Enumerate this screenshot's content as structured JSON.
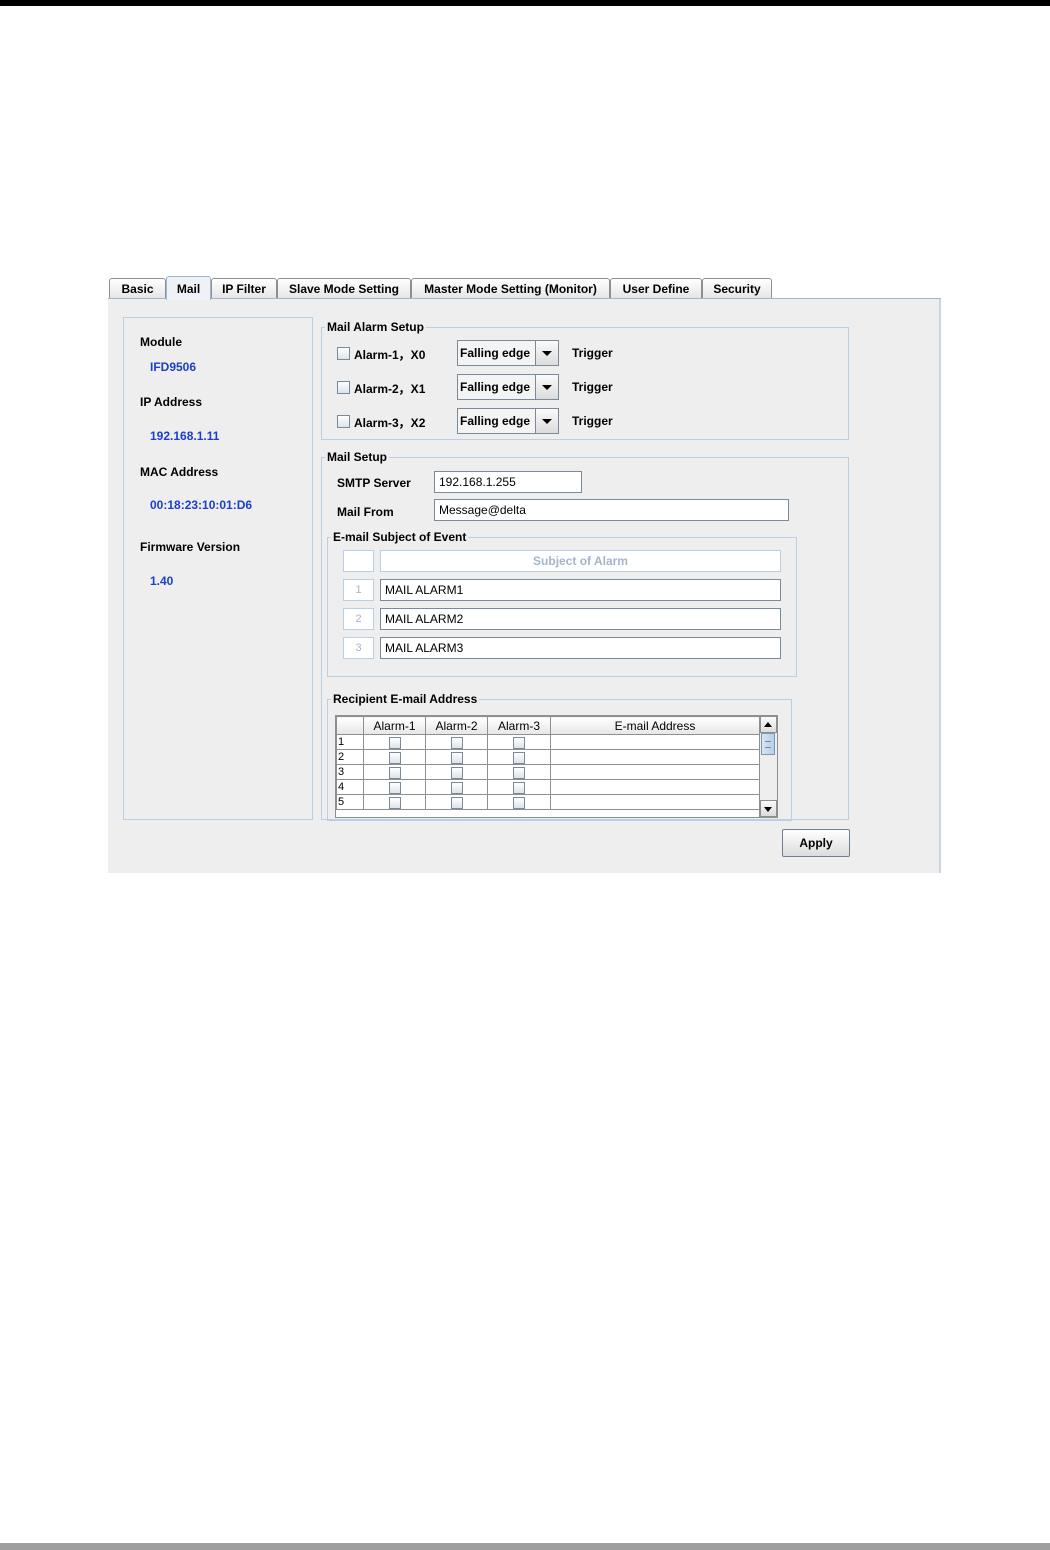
{
  "tabs": [
    {
      "label": "Basic",
      "active": false
    },
    {
      "label": "Mail",
      "active": true
    },
    {
      "label": "IP Filter",
      "active": false
    },
    {
      "label": "Slave Mode Setting",
      "active": false
    },
    {
      "label": "Master Mode Setting (Monitor)",
      "active": false
    },
    {
      "label": "User Define",
      "active": false
    },
    {
      "label": "Security",
      "active": false
    }
  ],
  "info": {
    "module_label": "Module",
    "module_value": "IFD9506",
    "ip_label": "IP Address",
    "ip_value": "192.168.1.11",
    "mac_label": "MAC Address",
    "mac_value": "00:18:23:10:01:D6",
    "firmware_label": "Firmware Version",
    "firmware_value": "1.40"
  },
  "mail_alarm_setup": {
    "title": "Mail Alarm Setup",
    "trigger_label": "Trigger",
    "alarms": [
      {
        "label": "Alarm-1，X0",
        "checked": false,
        "edge": "Falling edge"
      },
      {
        "label": "Alarm-2，X1",
        "checked": false,
        "edge": "Falling edge"
      },
      {
        "label": "Alarm-3，X2",
        "checked": false,
        "edge": "Falling edge"
      }
    ]
  },
  "mail_setup": {
    "title": "Mail Setup",
    "smtp_label": "SMTP Server",
    "smtp_value": "192.168.1.255",
    "from_label": "Mail From",
    "from_value": "Message@delta"
  },
  "subject": {
    "title": "E-mail Subject of Event",
    "header": "Subject of Alarm",
    "rows": [
      {
        "num": "1",
        "value": "MAIL ALARM1"
      },
      {
        "num": "2",
        "value": "MAIL ALARM2"
      },
      {
        "num": "3",
        "value": "MAIL ALARM3"
      }
    ]
  },
  "recipients": {
    "title": "Recipient E-mail Address",
    "columns": [
      "",
      "Alarm-1",
      "Alarm-2",
      "Alarm-3",
      "E-mail Address"
    ],
    "rows": [
      {
        "idx": "1",
        "a1": false,
        "a2": false,
        "a3": false,
        "email": ""
      },
      {
        "idx": "2",
        "a1": false,
        "a2": false,
        "a3": false,
        "email": ""
      },
      {
        "idx": "3",
        "a1": false,
        "a2": false,
        "a3": false,
        "email": ""
      },
      {
        "idx": "4",
        "a1": false,
        "a2": false,
        "a3": false,
        "email": ""
      },
      {
        "idx": "5",
        "a1": false,
        "a2": false,
        "a3": false,
        "email": ""
      }
    ]
  },
  "apply_label": "Apply",
  "icons": {
    "combo_arrow": "chevron-down-icon",
    "scroll_up": "arrow-up-icon",
    "scroll_down": "arrow-down-icon"
  },
  "colors": {
    "value_text": "#1b3fc6",
    "group_border": "#b8cfe5",
    "panel_bg": "#eeeeee"
  }
}
